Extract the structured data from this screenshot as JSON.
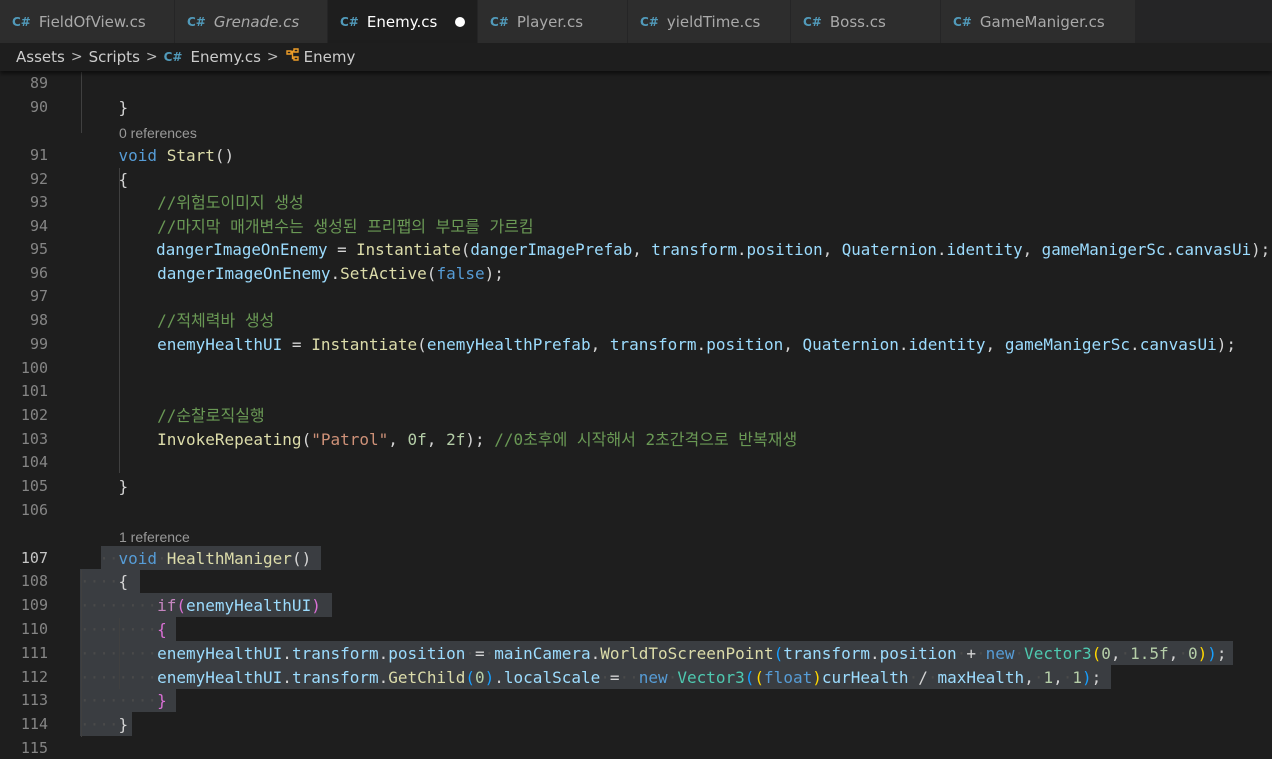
{
  "tabs": [
    {
      "label": "FieldOfView.cs",
      "italic": false,
      "active": false
    },
    {
      "label": "Grenade.cs",
      "italic": true,
      "active": false
    },
    {
      "label": "Enemy.cs",
      "italic": false,
      "active": true,
      "dirty": true
    },
    {
      "label": "Player.cs",
      "italic": false,
      "active": false
    },
    {
      "label": "yieldTime.cs",
      "italic": false,
      "active": false
    },
    {
      "label": "Boss.cs",
      "italic": false,
      "active": false
    },
    {
      "label": "GameManiger.cs",
      "italic": false,
      "active": false
    }
  ],
  "tab_icon_glyph": "C#",
  "breadcrumb": {
    "parts": [
      "Assets",
      "Scripts",
      "Enemy.cs",
      "Enemy"
    ],
    "separator": ">"
  },
  "codelens": {
    "start": "0 references",
    "healthmaniger": "1 reference"
  },
  "current_line": 107,
  "lines": [
    {
      "n": 89,
      "tokens": []
    },
    {
      "n": 90,
      "tokens": [
        {
          "t": "    }",
          "c": "pl"
        }
      ]
    },
    {
      "n": 91,
      "tokens": [
        {
          "t": "    ",
          "c": "pl"
        },
        {
          "t": "void",
          "c": "kw"
        },
        {
          "t": " ",
          "c": "pl"
        },
        {
          "t": "Start",
          "c": "fn"
        },
        {
          "t": "()",
          "c": "pl"
        }
      ]
    },
    {
      "n": 92,
      "tokens": [
        {
          "t": "    {",
          "c": "pl"
        }
      ]
    },
    {
      "n": 93,
      "tokens": [
        {
          "t": "        ",
          "c": "pl"
        },
        {
          "t": "//위험도이미지 생성",
          "c": "cmt"
        }
      ]
    },
    {
      "n": 94,
      "tokens": [
        {
          "t": "        ",
          "c": "pl"
        },
        {
          "t": "//마지막 매개변수는 생성된 프리팹의 부모를 가르킴",
          "c": "cmt"
        }
      ]
    },
    {
      "n": 95,
      "tokens": [
        {
          "t": "        ",
          "c": "pl"
        },
        {
          "t": "dangerImageOnEnemy",
          "c": "var"
        },
        {
          "t": " = ",
          "c": "pl"
        },
        {
          "t": "Instantiate",
          "c": "fn"
        },
        {
          "t": "(",
          "c": "pl"
        },
        {
          "t": "dangerImagePrefab",
          "c": "var"
        },
        {
          "t": ", ",
          "c": "pl"
        },
        {
          "t": "transform",
          "c": "var"
        },
        {
          "t": ".",
          "c": "pl"
        },
        {
          "t": "position",
          "c": "var"
        },
        {
          "t": ", ",
          "c": "pl"
        },
        {
          "t": "Quaternion",
          "c": "var"
        },
        {
          "t": ".",
          "c": "pl"
        },
        {
          "t": "identity",
          "c": "var"
        },
        {
          "t": ", ",
          "c": "pl"
        },
        {
          "t": "gameManigerSc",
          "c": "var"
        },
        {
          "t": ".",
          "c": "pl"
        },
        {
          "t": "canvasUi",
          "c": "var"
        },
        {
          "t": ");",
          "c": "pl"
        }
      ]
    },
    {
      "n": 96,
      "tokens": [
        {
          "t": "        ",
          "c": "pl"
        },
        {
          "t": "dangerImageOnEnemy",
          "c": "var"
        },
        {
          "t": ".",
          "c": "pl"
        },
        {
          "t": "SetActive",
          "c": "fn"
        },
        {
          "t": "(",
          "c": "pl"
        },
        {
          "t": "false",
          "c": "kw"
        },
        {
          "t": ");",
          "c": "pl"
        }
      ]
    },
    {
      "n": 97,
      "tokens": []
    },
    {
      "n": 98,
      "tokens": [
        {
          "t": "        ",
          "c": "pl"
        },
        {
          "t": "//적체력바 생성",
          "c": "cmt"
        }
      ]
    },
    {
      "n": 99,
      "tokens": [
        {
          "t": "        ",
          "c": "pl"
        },
        {
          "t": "enemyHealthUI",
          "c": "var"
        },
        {
          "t": " = ",
          "c": "pl"
        },
        {
          "t": "Instantiate",
          "c": "fn"
        },
        {
          "t": "(",
          "c": "pl"
        },
        {
          "t": "enemyHealthPrefab",
          "c": "var"
        },
        {
          "t": ", ",
          "c": "pl"
        },
        {
          "t": "transform",
          "c": "var"
        },
        {
          "t": ".",
          "c": "pl"
        },
        {
          "t": "position",
          "c": "var"
        },
        {
          "t": ", ",
          "c": "pl"
        },
        {
          "t": "Quaternion",
          "c": "var"
        },
        {
          "t": ".",
          "c": "pl"
        },
        {
          "t": "identity",
          "c": "var"
        },
        {
          "t": ", ",
          "c": "pl"
        },
        {
          "t": "gameManigerSc",
          "c": "var"
        },
        {
          "t": ".",
          "c": "pl"
        },
        {
          "t": "canvasUi",
          "c": "var"
        },
        {
          "t": ");",
          "c": "pl"
        }
      ]
    },
    {
      "n": 100,
      "tokens": []
    },
    {
      "n": 101,
      "tokens": []
    },
    {
      "n": 102,
      "tokens": [
        {
          "t": "        ",
          "c": "pl"
        },
        {
          "t": "//순찰로직실행",
          "c": "cmt"
        }
      ]
    },
    {
      "n": 103,
      "tokens": [
        {
          "t": "        ",
          "c": "pl"
        },
        {
          "t": "InvokeRepeating",
          "c": "fn"
        },
        {
          "t": "(",
          "c": "pl"
        },
        {
          "t": "\"Patrol\"",
          "c": "str"
        },
        {
          "t": ", ",
          "c": "pl"
        },
        {
          "t": "0f",
          "c": "num"
        },
        {
          "t": ", ",
          "c": "pl"
        },
        {
          "t": "2f",
          "c": "num"
        },
        {
          "t": "); ",
          "c": "pl"
        },
        {
          "t": "//0초후에 시작해서 2초간격으로 반복재생",
          "c": "cmt"
        }
      ]
    },
    {
      "n": 104,
      "tokens": []
    },
    {
      "n": 105,
      "tokens": [
        {
          "t": "    }",
          "c": "pl"
        }
      ]
    },
    {
      "n": 106,
      "tokens": []
    },
    {
      "n": 107,
      "tokens": [
        {
          "t": "  ",
          "c": "pl"
        },
        {
          "t": "··",
          "c": "ws"
        },
        {
          "t": "void",
          "c": "kw"
        },
        {
          "t": "·",
          "c": "ws"
        },
        {
          "t": "HealthManiger",
          "c": "fn"
        },
        {
          "t": "()",
          "c": "pl"
        }
      ]
    },
    {
      "n": 108,
      "tokens": [
        {
          "t": "····",
          "c": "ws"
        },
        {
          "t": "{",
          "c": "pl"
        }
      ]
    },
    {
      "n": 109,
      "tokens": [
        {
          "t": "········",
          "c": "ws"
        },
        {
          "t": "if",
          "c": "ctl"
        },
        {
          "t": "(",
          "c": "br2"
        },
        {
          "t": "enemyHealthUI",
          "c": "var"
        },
        {
          "t": ")",
          "c": "br2"
        }
      ]
    },
    {
      "n": 110,
      "tokens": [
        {
          "t": "········",
          "c": "ws"
        },
        {
          "t": "{",
          "c": "br2"
        }
      ]
    },
    {
      "n": 111,
      "tokens": [
        {
          "t": "········",
          "c": "ws"
        },
        {
          "t": "enemyHealthUI",
          "c": "var"
        },
        {
          "t": ".",
          "c": "pl"
        },
        {
          "t": "transform",
          "c": "var"
        },
        {
          "t": ".",
          "c": "pl"
        },
        {
          "t": "position",
          "c": "var"
        },
        {
          "t": "·",
          "c": "ws"
        },
        {
          "t": "=",
          "c": "pl"
        },
        {
          "t": "·",
          "c": "ws"
        },
        {
          "t": "mainCamera",
          "c": "var"
        },
        {
          "t": ".",
          "c": "pl"
        },
        {
          "t": "WorldToScreenPoint",
          "c": "fn"
        },
        {
          "t": "(",
          "c": "br3"
        },
        {
          "t": "transform",
          "c": "var"
        },
        {
          "t": ".",
          "c": "pl"
        },
        {
          "t": "position",
          "c": "var"
        },
        {
          "t": "·",
          "c": "ws"
        },
        {
          "t": "+",
          "c": "pl"
        },
        {
          "t": "·",
          "c": "ws"
        },
        {
          "t": "new",
          "c": "kw"
        },
        {
          "t": "·",
          "c": "ws"
        },
        {
          "t": "Vector3",
          "c": "type"
        },
        {
          "t": "(",
          "c": "br1"
        },
        {
          "t": "0",
          "c": "num"
        },
        {
          "t": ",",
          "c": "pl"
        },
        {
          "t": "·",
          "c": "ws"
        },
        {
          "t": "1.5f",
          "c": "num"
        },
        {
          "t": ",",
          "c": "pl"
        },
        {
          "t": "·",
          "c": "ws"
        },
        {
          "t": "0",
          "c": "num"
        },
        {
          "t": ")",
          "c": "br1"
        },
        {
          "t": ")",
          "c": "br3"
        },
        {
          "t": ";",
          "c": "pl"
        }
      ]
    },
    {
      "n": 112,
      "tokens": [
        {
          "t": "········",
          "c": "ws"
        },
        {
          "t": "enemyHealthUI",
          "c": "var"
        },
        {
          "t": ".",
          "c": "pl"
        },
        {
          "t": "transform",
          "c": "var"
        },
        {
          "t": ".",
          "c": "pl"
        },
        {
          "t": "GetChild",
          "c": "fn"
        },
        {
          "t": "(",
          "c": "br3"
        },
        {
          "t": "0",
          "c": "num"
        },
        {
          "t": ")",
          "c": "br3"
        },
        {
          "t": ".",
          "c": "pl"
        },
        {
          "t": "localScale",
          "c": "var"
        },
        {
          "t": "·",
          "c": "ws"
        },
        {
          "t": "=",
          "c": "pl"
        },
        {
          "t": "··",
          "c": "ws"
        },
        {
          "t": "new",
          "c": "kw"
        },
        {
          "t": "·",
          "c": "ws"
        },
        {
          "t": "Vector3",
          "c": "type"
        },
        {
          "t": "(",
          "c": "br3"
        },
        {
          "t": "(",
          "c": "br1"
        },
        {
          "t": "float",
          "c": "kw"
        },
        {
          "t": ")",
          "c": "br1"
        },
        {
          "t": "curHealth",
          "c": "var"
        },
        {
          "t": "·",
          "c": "ws"
        },
        {
          "t": "/",
          "c": "pl"
        },
        {
          "t": "·",
          "c": "ws"
        },
        {
          "t": "maxHealth",
          "c": "var"
        },
        {
          "t": ",",
          "c": "pl"
        },
        {
          "t": "·",
          "c": "ws"
        },
        {
          "t": "1",
          "c": "num"
        },
        {
          "t": ",",
          "c": "pl"
        },
        {
          "t": "·",
          "c": "ws"
        },
        {
          "t": "1",
          "c": "num"
        },
        {
          "t": ")",
          "c": "br3"
        },
        {
          "t": ";",
          "c": "pl"
        }
      ]
    },
    {
      "n": 113,
      "tokens": [
        {
          "t": "········",
          "c": "ws"
        },
        {
          "t": "}",
          "c": "br2"
        }
      ]
    },
    {
      "n": 114,
      "tokens": [
        {
          "t": "····",
          "c": "ws"
        },
        {
          "t": "}",
          "c": "pl"
        }
      ]
    },
    {
      "n": 115,
      "tokens": []
    }
  ]
}
